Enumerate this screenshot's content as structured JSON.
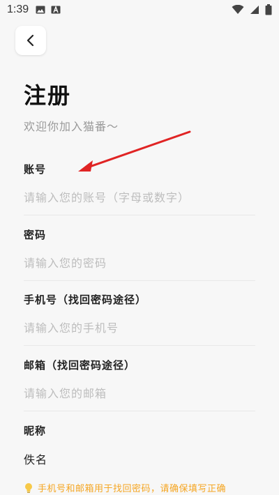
{
  "status_bar": {
    "time": "1:39"
  },
  "header": {
    "title": "注册",
    "subtitle": "欢迎你加入猫番～"
  },
  "form": {
    "account": {
      "label": "账号",
      "placeholder": "请输入您的账号（字母或数字）",
      "value": ""
    },
    "password": {
      "label": "密码",
      "placeholder": "请输入您的密码",
      "value": ""
    },
    "phone": {
      "label": "手机号（找回密码途径）",
      "placeholder": "请输入您的手机号",
      "value": ""
    },
    "email": {
      "label": "邮箱（找回密码途径）",
      "placeholder": "请输入您的邮箱",
      "value": ""
    },
    "nickname": {
      "label": "昵称",
      "placeholder": "",
      "value": "佚名"
    }
  },
  "hint": {
    "text": "手机号和邮箱用于找回密码，请确保填写正确",
    "color": "#f5a623"
  },
  "colors": {
    "background": "#f7f7f7",
    "annotation_arrow": "#e02424"
  }
}
